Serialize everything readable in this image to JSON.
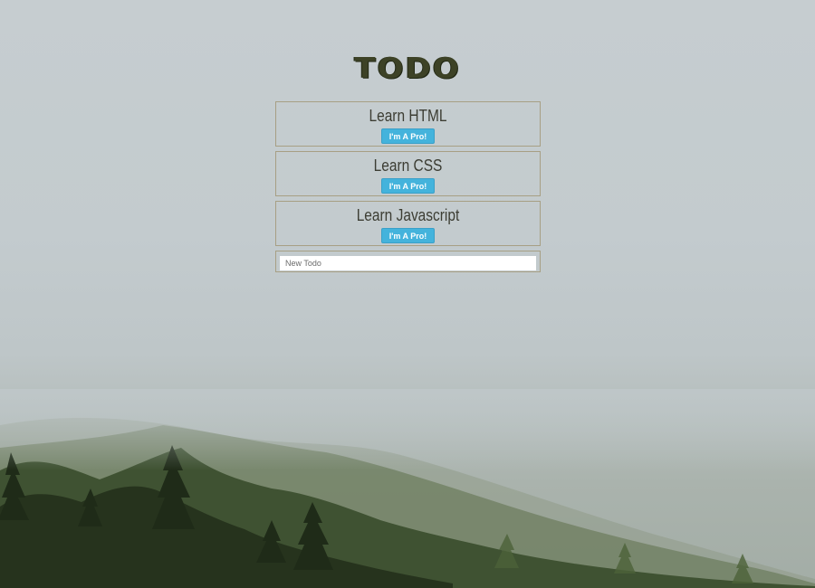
{
  "app": {
    "title": "TODO"
  },
  "todos": [
    {
      "text": "Learn HTML",
      "button_label": "I'm A Pro!"
    },
    {
      "text": "Learn CSS",
      "button_label": "I'm A Pro!"
    },
    {
      "text": "Learn Javascript",
      "button_label": "I'm A Pro!"
    }
  ],
  "new_todo": {
    "placeholder": "New Todo",
    "value": ""
  },
  "colors": {
    "title": "#3d4226",
    "button": "#44b3dc",
    "item_border": "#a79f84"
  }
}
